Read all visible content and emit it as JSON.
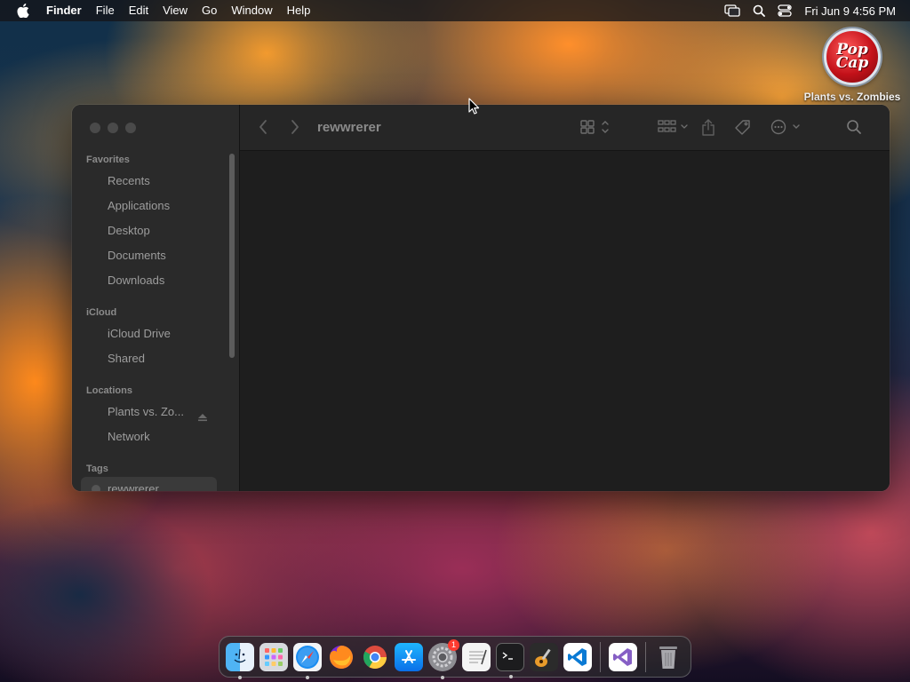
{
  "menubar": {
    "app_name": "Finder",
    "items": [
      "File",
      "Edit",
      "View",
      "Go",
      "Window",
      "Help"
    ],
    "clock": "Fri Jun 9  4:56 PM"
  },
  "desktop": {
    "icon_text_line1": "Pop",
    "icon_text_line2": "Cap",
    "icon_label": "Plants vs. Zombies"
  },
  "finder": {
    "window_title": "rewwrerer",
    "sidebar": {
      "favorites_header": "Favorites",
      "favorites": [
        "Recents",
        "Applications",
        "Desktop",
        "Documents",
        "Downloads"
      ],
      "icloud_header": "iCloud",
      "icloud": [
        "iCloud Drive",
        "Shared"
      ],
      "locations_header": "Locations",
      "locations": [
        "Plants vs. Zo...",
        "Network"
      ],
      "tags_header": "Tags",
      "tags": [
        "rewwrerer"
      ]
    }
  },
  "dock": {
    "apps": [
      "Finder",
      "Launchpad",
      "Safari",
      "Firefox",
      "Chrome",
      "App Store",
      "System Settings",
      "TextEdit",
      "Terminal",
      "GarageBand",
      "Visual Studio Code",
      "Visual Studio",
      "Trash"
    ],
    "settings_badge": "1"
  },
  "colors": {
    "window_bg": "#1e1e1e",
    "sidebar_bg": "#2a2a2a",
    "menubar_bg": "#141418"
  }
}
